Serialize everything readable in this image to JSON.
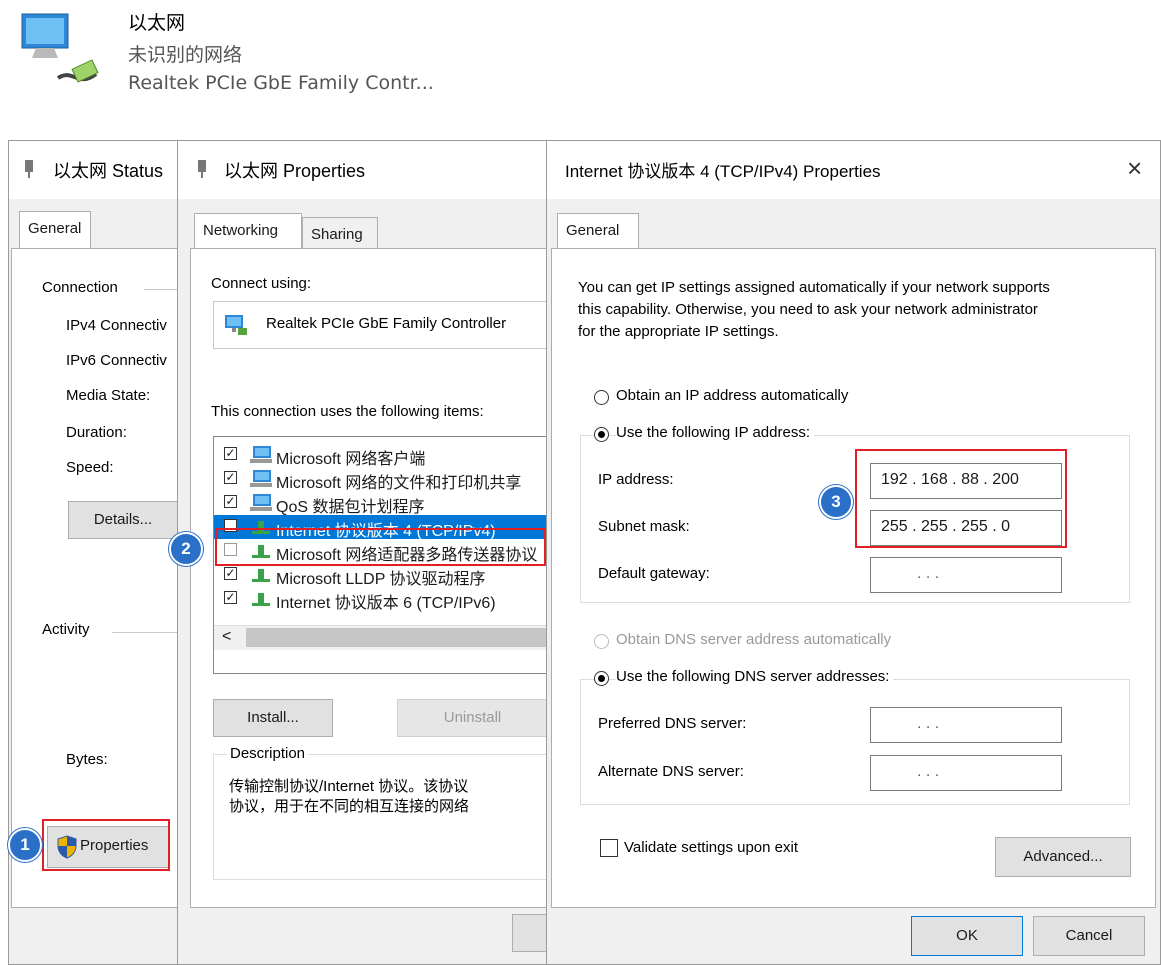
{
  "adapter": {
    "name": "以太网",
    "status": "未识别的网络",
    "device": "Realtek PCIe GbE Family Contr..."
  },
  "status_dialog": {
    "title": "以太网 Status",
    "tab": "General",
    "connection_heading": "Connection",
    "rows": [
      "IPv4 Connectiv",
      "IPv6 Connectiv",
      "Media State:",
      "Duration:",
      "Speed:"
    ],
    "details_button": "Details...",
    "activity_heading": "Activity",
    "bytes_label": "Bytes:",
    "properties_button": "Properties"
  },
  "properties_dialog": {
    "title": "以太网 Properties",
    "tabs": [
      "Networking",
      "Sharing"
    ],
    "connect_using_label": "Connect using:",
    "adapter_name": "Realtek PCIe GbE Family Controller",
    "items_label": "This connection uses the following items:",
    "items": [
      {
        "text": "Microsoft 网络客户端",
        "checked": true
      },
      {
        "text": "Microsoft 网络的文件和打印机共享",
        "checked": true
      },
      {
        "text": "QoS 数据包计划程序",
        "checked": true
      },
      {
        "text": "Internet 协议版本 4 (TCP/IPv4)",
        "checked": true
      },
      {
        "text": "Microsoft 网络适配器多路传送器协议",
        "checked": false
      },
      {
        "text": "Microsoft LLDP 协议驱动程序",
        "checked": true
      },
      {
        "text": "Internet 协议版本 6 (TCP/IPv6)",
        "checked": true
      }
    ],
    "scroll_left": "<",
    "install_button": "Install...",
    "uninstall_button": "Uninstall",
    "description_heading": "Description",
    "description_line1": "传输控制协议/Internet 协议。该协议",
    "description_line2": "协议，用于在不同的相互连接的网络"
  },
  "ipv4_dialog": {
    "title": "Internet 协议版本 4 (TCP/IPv4) Properties",
    "close_glyph": "×",
    "tab": "General",
    "intro_line1": "You can get IP settings assigned automatically if your network supports",
    "intro_line2": "this capability. Otherwise, you need to ask your network administrator",
    "intro_line3": "for the appropriate IP settings.",
    "radio_auto_ip": "Obtain an IP address automatically",
    "radio_manual_ip": "Use the following IP address:",
    "ip_label": "IP address:",
    "ip_value": "192 . 168 . 88 . 200",
    "mask_label": "Subnet mask:",
    "mask_value": "255 . 255 . 255 .  0",
    "gateway_label": "Default gateway:",
    "empty_ip": ".        .        .",
    "radio_auto_dns": "Obtain DNS server address automatically",
    "radio_manual_dns": "Use the following DNS server addresses:",
    "preferred_dns_label": "Preferred DNS server:",
    "alternate_dns_label": "Alternate DNS server:",
    "validate_label": "Validate settings upon exit",
    "advanced_button": "Advanced...",
    "ok_button": "OK",
    "cancel_button": "Cancel"
  },
  "callouts": [
    "1",
    "2",
    "3"
  ],
  "colors": {
    "callout": "#e21f26",
    "badge": "#2a6fc8",
    "selection": "#0078d7"
  }
}
